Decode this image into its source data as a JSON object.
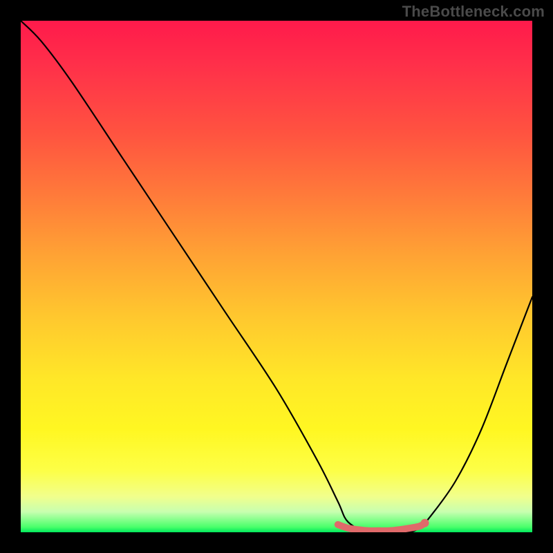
{
  "watermark": "TheBottleneck.com",
  "chart_data": {
    "type": "line",
    "title": "",
    "xlabel": "",
    "ylabel": "",
    "xlim": [
      0,
      100
    ],
    "ylim": [
      0,
      100
    ],
    "series": [
      {
        "name": "bottleneck-curve",
        "x": [
          0,
          4,
          10,
          20,
          30,
          40,
          50,
          58,
          62,
          64,
          68,
          72,
          76,
          78,
          80,
          85,
          90,
          95,
          100
        ],
        "values": [
          100,
          96,
          88,
          73,
          58,
          43,
          28,
          14,
          6,
          2,
          0,
          0,
          0,
          1,
          3,
          10,
          20,
          33,
          46
        ]
      },
      {
        "name": "optimal-band",
        "x": [
          62,
          64,
          66,
          68,
          70,
          72,
          74,
          76,
          78,
          79
        ],
        "values": [
          1.5,
          0.8,
          0.5,
          0.3,
          0.3,
          0.3,
          0.5,
          0.8,
          1.2,
          1.8
        ]
      }
    ],
    "colors": {
      "curve": "#000000",
      "optimal": "#e06a6a",
      "optimal_end_dot": "#e06a6a"
    },
    "gradient_stops": [
      {
        "pos": 0,
        "color": "#ff1a4b"
      },
      {
        "pos": 22,
        "color": "#ff5340"
      },
      {
        "pos": 46,
        "color": "#ffa334"
      },
      {
        "pos": 70,
        "color": "#ffe728"
      },
      {
        "pos": 93,
        "color": "#f1ff8c"
      },
      {
        "pos": 100,
        "color": "#00e85c"
      }
    ]
  }
}
